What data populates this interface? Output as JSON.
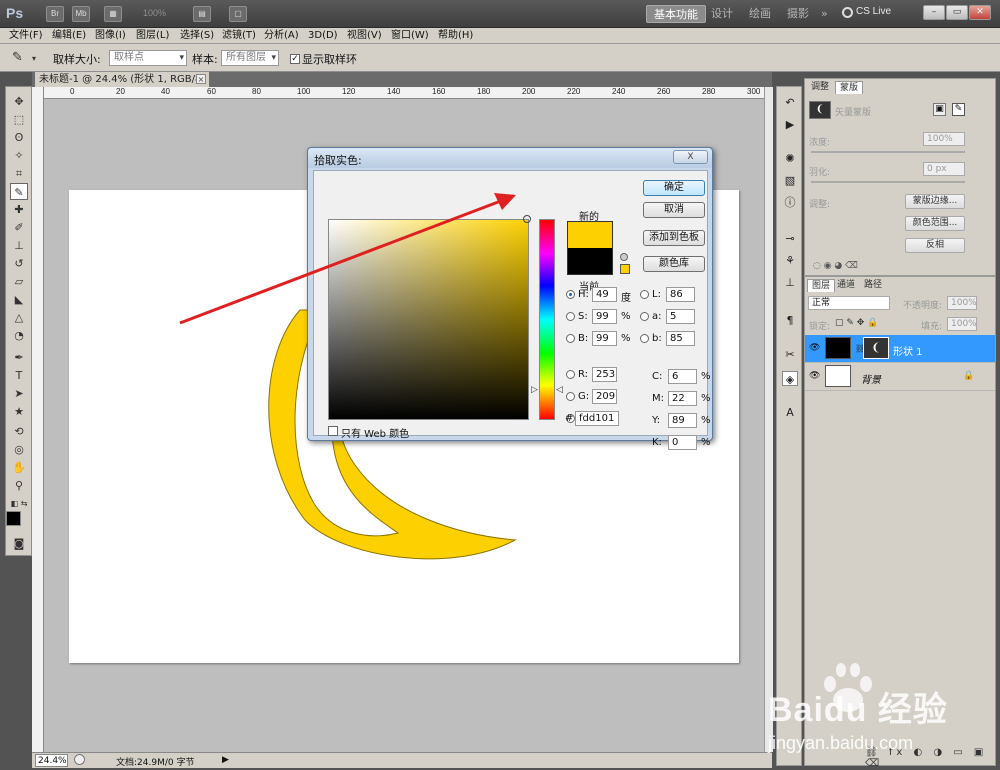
{
  "app": {
    "logo": "Ps",
    "zoom_preset": "100%",
    "workspaces": [
      "基本功能",
      "设计",
      "绘画",
      "摄影"
    ],
    "more": "»",
    "cslive": "CS Live",
    "win_min": "–",
    "win_restore": "▭",
    "win_close": "✕"
  },
  "menu": [
    "文件(F)",
    "编辑(E)",
    "图像(I)",
    "图层(L)",
    "选择(S)",
    "滤镜(T)",
    "分析(A)",
    "3D(D)",
    "视图(V)",
    "窗口(W)",
    "帮助(H)"
  ],
  "options_bar": {
    "sample_size_label": "取样大小:",
    "sample_size_value": "取样点",
    "sample_label": "样本:",
    "sample_value": "所有图层",
    "show_ring_label": "显示取样环",
    "show_ring_checked": true
  },
  "document": {
    "tab_title": "未标题-1 @ 24.4% (形状 1, RGB/8) *",
    "close": "×",
    "ruler_labels": [
      "0",
      "20",
      "40",
      "60",
      "80",
      "100",
      "120",
      "140",
      "160",
      "180",
      "200",
      "220",
      "240",
      "260",
      "280",
      "300"
    ],
    "zoom": "24.4%",
    "info": "文档:24.9M/0 字节",
    "shape_color": "#fdd101"
  },
  "panels": {
    "adjust_tab": "调整",
    "mask_tab": "蒙版",
    "mask_title": "矢量蒙版",
    "density_label": "浓度:",
    "density_value": "100%",
    "feather_label": "羽化:",
    "feather_value": "0 px",
    "adjust_label": "调整:",
    "mask_edge_btn": "蒙版边缘...",
    "color_range_btn": "颜色范围...",
    "invert_btn": "反相",
    "layers_tab": "图层",
    "channels_tab": "通道",
    "paths_tab": "路径",
    "blend_mode": "正常",
    "opacity_label": "不透明度:",
    "opacity_value": "100%",
    "lock_label": "锁定:",
    "fill_label": "填充:",
    "fill_value": "100%",
    "layers": [
      {
        "name": "形状 1",
        "selected": true
      },
      {
        "name": "背景",
        "selected": false
      }
    ]
  },
  "dialog": {
    "title": "拾取实色:",
    "close": "X",
    "new_label": "新的",
    "current_label": "当前",
    "new_color": "#fdd101",
    "current_color": "#000000",
    "ok": "确定",
    "cancel": "取消",
    "add_swatch": "添加到色板",
    "color_libraries": "颜色库",
    "hsb": [
      {
        "label": "H:",
        "value": "49",
        "unit": "度",
        "selected": true
      },
      {
        "label": "S:",
        "value": "99",
        "unit": "%",
        "selected": false
      },
      {
        "label": "B:",
        "value": "99",
        "unit": "%",
        "selected": false
      }
    ],
    "rgb": [
      {
        "label": "R:",
        "value": "253"
      },
      {
        "label": "G:",
        "value": "209"
      },
      {
        "label": "B:",
        "value": "1"
      }
    ],
    "lab": [
      {
        "label": "L:",
        "value": "86"
      },
      {
        "label": "a:",
        "value": "5"
      },
      {
        "label": "b:",
        "value": "85"
      }
    ],
    "cmyk": [
      {
        "label": "C:",
        "value": "6",
        "unit": "%"
      },
      {
        "label": "M:",
        "value": "22",
        "unit": "%"
      },
      {
        "label": "Y:",
        "value": "89",
        "unit": "%"
      },
      {
        "label": "K:",
        "value": "0",
        "unit": "%"
      }
    ],
    "web_only_label": "只有 Web 颜色",
    "hash": "#",
    "hex": "fdd101"
  },
  "annotation": {
    "color": "#e02020"
  },
  "watermark": {
    "brand": "Baidu 经验",
    "site": "jingyan.baidu.com"
  }
}
